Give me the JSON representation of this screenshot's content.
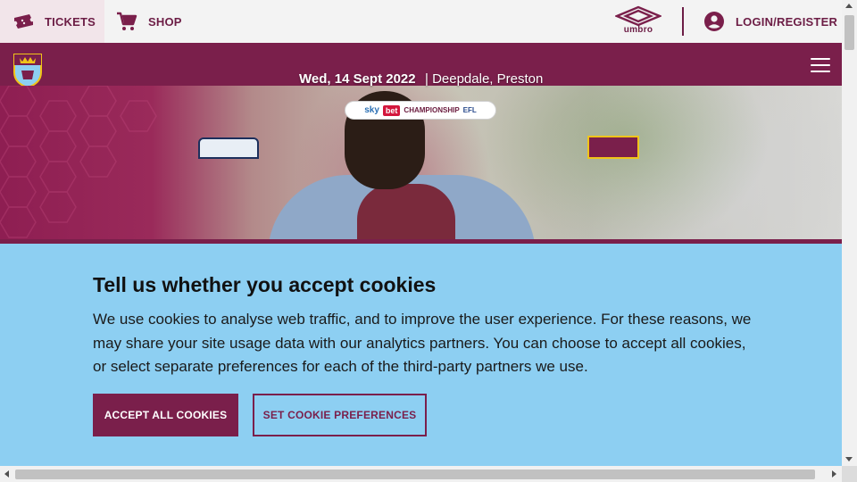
{
  "topbar": {
    "tickets_label": "TICKETS",
    "shop_label": "SHOP",
    "sponsor_name": "umbro",
    "login_label": "LOGIN/REGISTER",
    "icons": [
      "ticket-icon",
      "cart-icon",
      "umbro-logo",
      "account-icon"
    ]
  },
  "nav": {
    "icons": [
      "club-crest",
      "hamburger-menu-icon"
    ]
  },
  "hero": {
    "match_date": "Wed, 14 Sept 2022",
    "match_venue": "| Deepdale, Preston",
    "competition": {
      "sky": "sky",
      "bet": "bet",
      "name": "CHAMPIONSHIP",
      "league": "EFL"
    }
  },
  "cookie_banner": {
    "title": "Tell us whether you accept cookies",
    "body": "We use cookies to analyse web traffic, and to improve the user experience. For these reasons, we may share your site usage data with our analytics partners. You can choose to accept all cookies, or select separate preferences for each of the third-party partners we use.",
    "accept_label": "ACCEPT ALL COOKIES",
    "preferences_label": "SET COOKIE PREFERENCES"
  },
  "colors": {
    "brand_claret": "#7a1f4b",
    "banner_sky_blue": "#8dcff2",
    "topbar_bg": "#f3f3f3"
  }
}
